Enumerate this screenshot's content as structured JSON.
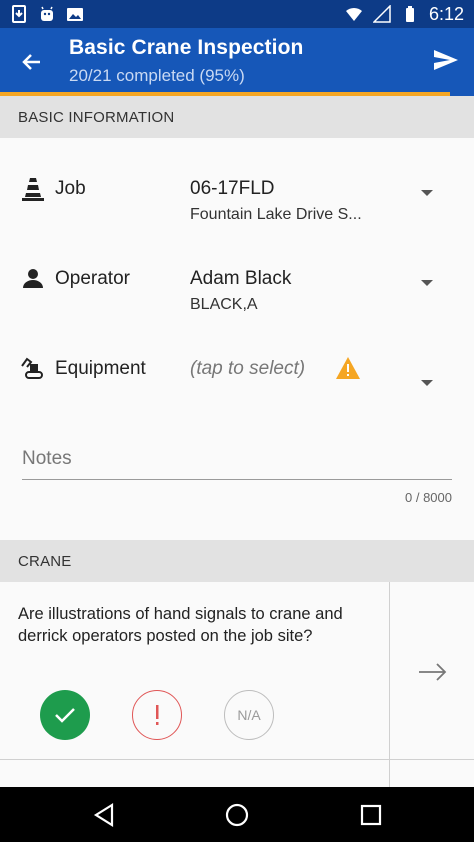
{
  "status_bar": {
    "time": "6:12",
    "icons": [
      "sim-download-icon",
      "android-debug-icon",
      "photo-notification-icon",
      "wifi-icon",
      "signal-icon",
      "battery-icon"
    ]
  },
  "app_bar": {
    "title": "Basic Crane Inspection",
    "subtitle": "20/21 completed (95%)",
    "progress": 0.95,
    "colors": {
      "primary": "#1657b8",
      "status_bar": "#0d3b87",
      "accent": "#f5a623"
    }
  },
  "basic_info": {
    "header": "BASIC INFORMATION",
    "fields": [
      {
        "icon": "traffic-cone-icon",
        "label": "Job",
        "value": "06-17FLD",
        "sub": "Fountain Lake Drive S..."
      },
      {
        "icon": "person-icon",
        "label": "Operator",
        "value": "Adam Black",
        "sub": "BLACK,A"
      },
      {
        "icon": "excavator-icon",
        "label": "Equipment",
        "placeholder": "(tap to select)",
        "warning": "warning-icon"
      }
    ],
    "notes": {
      "placeholder": "Notes",
      "counter": "0 / 8000"
    }
  },
  "crane": {
    "header": "CRANE",
    "question": "Are illustrations of hand signals to crane and derrick operators posted on the job site?",
    "answers": {
      "yes": "check-icon",
      "no": "exclamation-icon",
      "na": "N/A"
    },
    "colors": {
      "yes": "#1e9c4d",
      "no": "#e05656"
    }
  },
  "nav_bar": {
    "icons": [
      "back-triangle-icon",
      "home-circle-icon",
      "recents-square-icon"
    ]
  }
}
